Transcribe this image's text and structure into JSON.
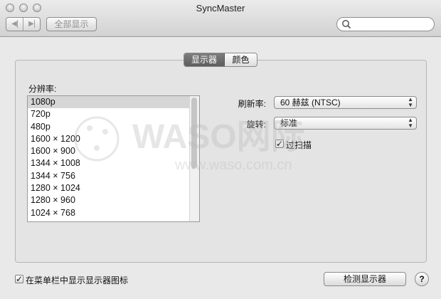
{
  "window": {
    "title": "SyncMaster"
  },
  "toolbar": {
    "back_icon": "chevron-left",
    "forward_icon": "chevron-right",
    "show_all_label": "全部显示",
    "search_placeholder": ""
  },
  "tabs": [
    {
      "label": "显示器",
      "selected": true
    },
    {
      "label": "颜色",
      "selected": false
    }
  ],
  "resolution": {
    "label": "分辨率:",
    "items": [
      "1080p",
      "720p",
      "480p",
      "1600 × 1200",
      "1600 × 900",
      "1344 × 1008",
      "1344 × 756",
      "1280 × 1024",
      "1280 × 960",
      "1024 × 768"
    ],
    "selected_index": 0
  },
  "refresh": {
    "label": "刷新率:",
    "value": "60 赫兹 (NTSC)"
  },
  "rotation": {
    "label": "旋转:",
    "value": "标准"
  },
  "overscan": {
    "label": "过扫描",
    "checked": true
  },
  "menubar_option": {
    "label": "在菜单栏中显示显示器图标",
    "checked": true
  },
  "buttons": {
    "detect": "检测显示器",
    "help": "?"
  },
  "watermark": {
    "text": "WASO网际",
    "url": "www.waso.com.cn"
  },
  "colors": {
    "selected_tab": "#6a6a6a",
    "selected_row": "#d6d6d6"
  }
}
